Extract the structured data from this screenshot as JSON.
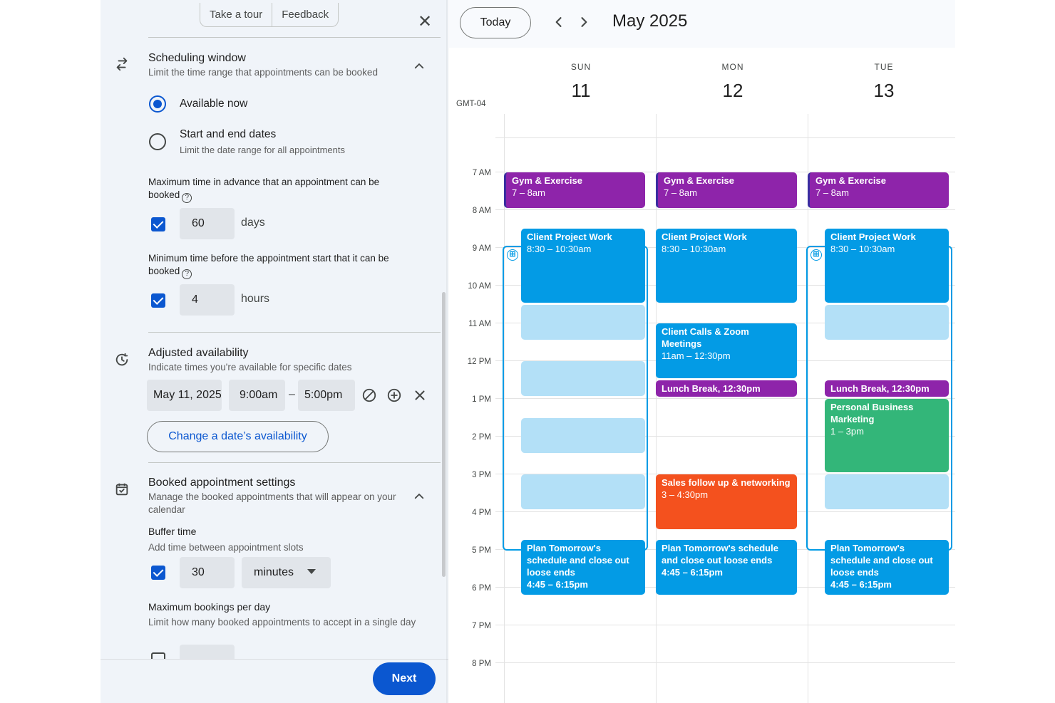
{
  "panel": {
    "top_buttons": [
      "Take a tour",
      "Feedback"
    ],
    "close": "✕",
    "scheduling_window": {
      "title": "Scheduling window",
      "subtitle": "Limit the time range that appointments can be booked",
      "option_available_now": "Available now",
      "option_start_end": "Start and end dates",
      "option_start_end_sub": "Limit the date range for all appointments",
      "max_advance_label": "Maximum time in advance that an appointment can be booked",
      "max_advance_value": "60",
      "max_advance_unit": "days",
      "min_before_label": "Minimum time before the appointment start that it can be booked",
      "min_before_value": "4",
      "min_before_unit": "hours"
    },
    "adjusted_availability": {
      "title": "Adjusted availability",
      "subtitle": "Indicate times you're available for specific dates",
      "date": "May 11, 2025",
      "start": "9:00am",
      "separator": "–",
      "end": "5:00pm",
      "change_button": "Change a date’s availability"
    },
    "booked_settings": {
      "title": "Booked appointment settings",
      "subtitle": "Manage the booked appointments that will appear on your calendar",
      "buffer_title": "Buffer time",
      "buffer_sub": "Add time between appointment slots",
      "buffer_value": "30",
      "buffer_unit": "minutes",
      "max_bookings_title": "Maximum bookings per day",
      "max_bookings_sub": "Limit how many booked appointments to accept in a single day"
    },
    "next_button": "Next"
  },
  "calendar": {
    "today_button": "Today",
    "month": "May 2025",
    "timezone": "GMT-04",
    "days": [
      {
        "dow": "SUN",
        "num": "11"
      },
      {
        "dow": "MON",
        "num": "12"
      },
      {
        "dow": "TUE",
        "num": "13"
      }
    ],
    "time_labels": [
      "7 AM",
      "8 AM",
      "9 AM",
      "10 AM",
      "11 AM",
      "12 PM",
      "1 PM",
      "2 PM",
      "3 PM",
      "4 PM",
      "5 PM",
      "6 PM",
      "7 PM",
      "8 PM"
    ],
    "events": {
      "sun_gym_title": "Gym & Exercise",
      "sun_gym_time": "7 – 8am",
      "mon_gym_title": "Gym & Exercise",
      "mon_gym_time": "7 – 8am",
      "tue_gym_title": "Gym & Exercise",
      "tue_gym_time": "7 – 8am",
      "sun_cpw_title": "Client Project Work",
      "sun_cpw_time": "8:30 – 10:30am",
      "mon_cpw_title": "Client Project Work",
      "mon_cpw_time": "8:30 – 10:30am",
      "tue_cpw_title": "Client Project Work",
      "tue_cpw_time": "8:30 – 10:30am",
      "mon_calls_title": "Client Calls & Zoom Meetings",
      "mon_calls_time": "11am – 12:30pm",
      "mon_lunch": "Lunch Break, 12:30pm",
      "tue_lunch": "Lunch Break, 12:30pm",
      "tue_pbm_title": "Personal Business Marketing",
      "tue_pbm_time": "1 – 3pm",
      "mon_sales_title": "Sales follow up & networking",
      "mon_sales_time": "3 – 4:30pm",
      "sun_plan_title": "Plan Tomorrow's schedule and close out loose ends",
      "sun_plan_time": "4:45 – 6:15pm",
      "mon_plan_title": "Plan Tomorrow's schedule and close out loose ends",
      "mon_plan_time": "4:45 – 6:15pm",
      "tue_plan_title": "Plan Tomorrow's schedule and close out loose ends",
      "tue_plan_time": "4:45 – 6:15pm"
    },
    "colors": {
      "purple": "#8e24aa",
      "blue": "#039be5",
      "green": "#33b679",
      "orange": "#f4511e",
      "slot": "#b3e0f7",
      "accent": "#0b57d0"
    }
  }
}
